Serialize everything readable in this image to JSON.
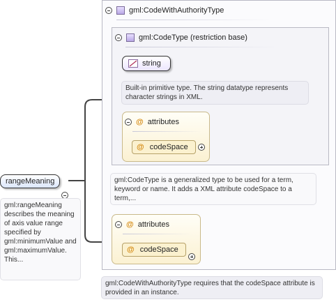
{
  "outer": {
    "title": "gml:CodeWithAuthorityType"
  },
  "inner": {
    "title": "gml:CodeType (restriction base)"
  },
  "string_node": {
    "label": "string"
  },
  "string_note": "Built-in primitive type. The string datatype represents character strings in XML.",
  "inner_attributes": {
    "label": "attributes",
    "item": "codeSpace"
  },
  "codetype_note": "gml:CodeType is a generalized type to be used for a term, keyword or name. It adds a XML attribute codeSpace to a term,...",
  "outer_attributes": {
    "label": "attributes",
    "item": "codeSpace"
  },
  "element": {
    "label": "rangeMeaning"
  },
  "element_note": "gml:rangeMeaning describes the meaning of axis value range specified by gml:minimumValue and gml:maximumValue. This...",
  "authority_note": "gml:CodeWithAuthorityType requires that the codeSpace attribute is provided in an instance.",
  "icons": {
    "attribute": "@"
  },
  "colors": {
    "connector": "#444444",
    "attribute_accent": "#d58a12",
    "complex_type": "#b9a7e6"
  }
}
